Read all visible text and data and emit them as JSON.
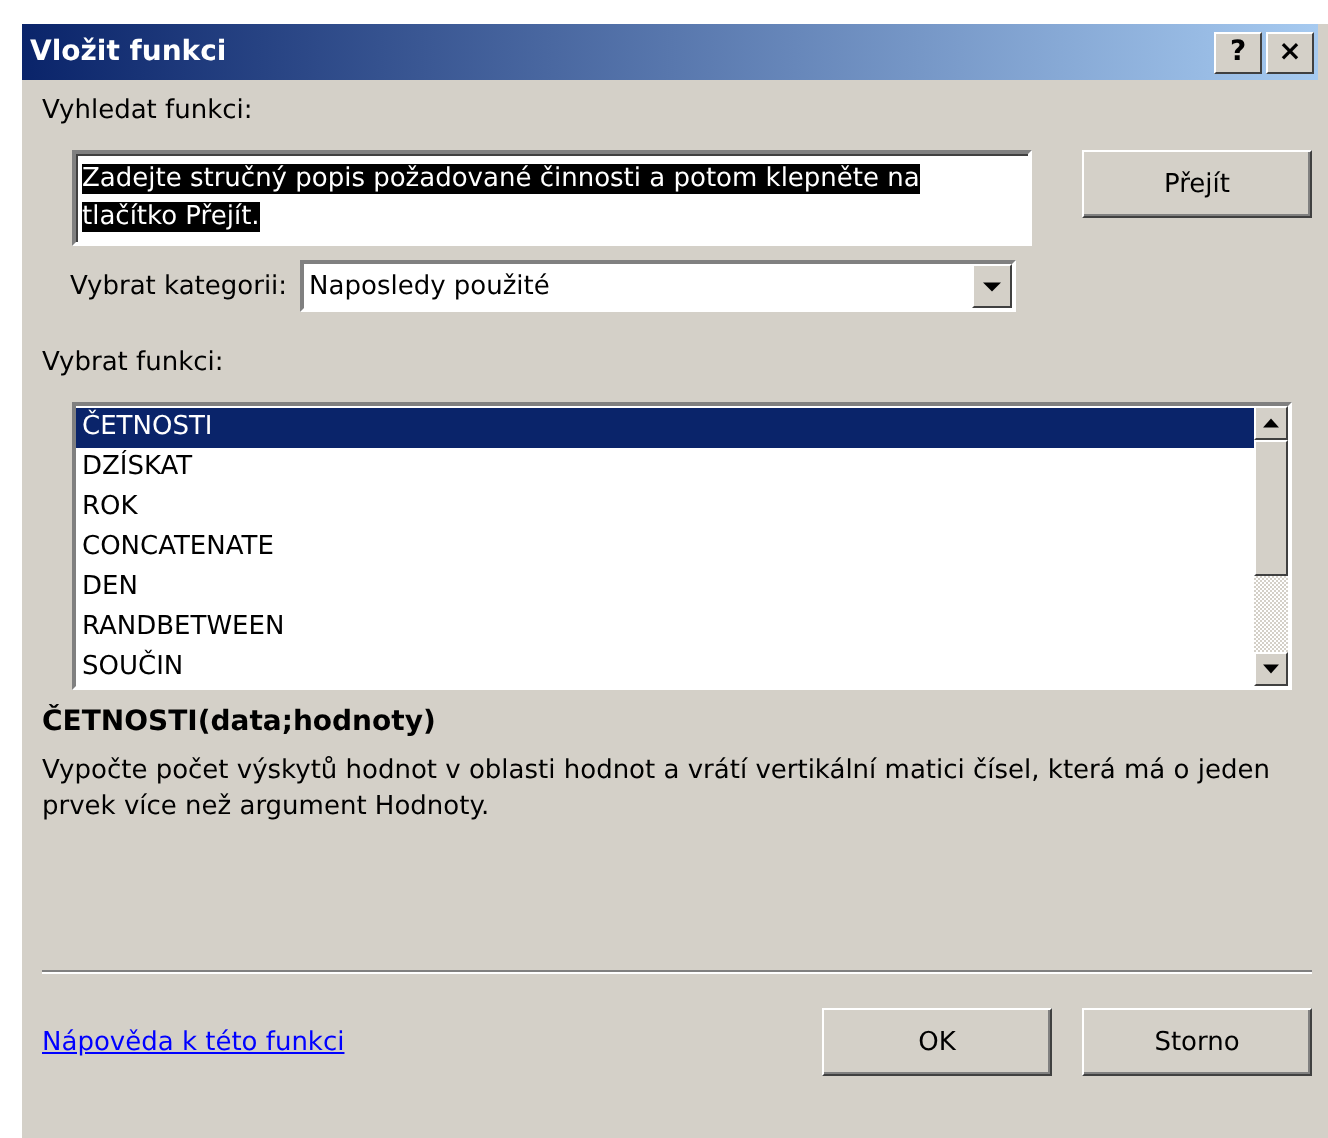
{
  "window": {
    "title": "Vložit funkci",
    "title_buttons": [
      "?",
      "×"
    ]
  },
  "search": {
    "label": "Vyhledat funkci:",
    "value": "Zadejte stručný popis požadované činnosti a potom klepněte na tlačítko Přejít.",
    "selected": true,
    "button": "Přejít"
  },
  "category": {
    "label": "Vybrat kategorii:",
    "value": "Naposledy použité"
  },
  "functions": {
    "label": "Vybrat funkci:",
    "items": [
      {
        "name": "ČETNOSTI",
        "selected": true
      },
      {
        "name": "DZÍSKAT",
        "selected": false
      },
      {
        "name": "ROK",
        "selected": false
      },
      {
        "name": "CONCATENATE",
        "selected": false
      },
      {
        "name": "DEN",
        "selected": false
      },
      {
        "name": "RANDBETWEEN",
        "selected": false
      },
      {
        "name": "SOUČIN",
        "selected": false
      }
    ]
  },
  "signature": "ČETNOSTI(data;hodnoty)",
  "description": "Vypočte počet výskytů hodnot v oblasti hodnot a vrátí vertikální matici čísel, která má o jeden prvek více než argument Hodnoty.",
  "help_link": "Nápověda k této funkci",
  "buttons": [
    "OK",
    "Storno"
  ]
}
